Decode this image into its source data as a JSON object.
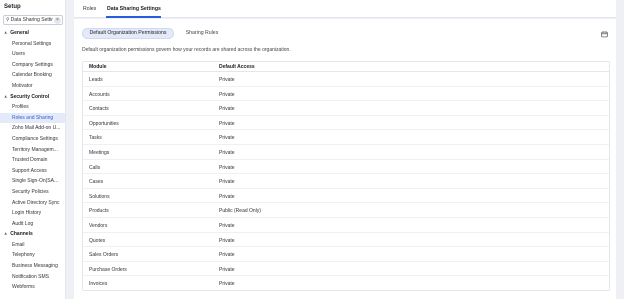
{
  "sidebar": {
    "title": "Setup",
    "search_value": "Data Sharing Settir",
    "items": [
      {
        "label": "General",
        "type": "section"
      },
      {
        "label": "Personal Settings",
        "type": "item"
      },
      {
        "label": "Users",
        "type": "item"
      },
      {
        "label": "Company Settings",
        "type": "item"
      },
      {
        "label": "Calendar Booking",
        "type": "item"
      },
      {
        "label": "Motivator",
        "type": "item"
      },
      {
        "label": "Security Control",
        "type": "section"
      },
      {
        "label": "Profiles",
        "type": "item"
      },
      {
        "label": "Roles and Sharing",
        "type": "active"
      },
      {
        "label": "Zoho Mail Add-on U...",
        "type": "item"
      },
      {
        "label": "Compliance Settings",
        "type": "item"
      },
      {
        "label": "Territory Managem...",
        "type": "item"
      },
      {
        "label": "Trusted Domain",
        "type": "item"
      },
      {
        "label": "Support Access",
        "type": "item"
      },
      {
        "label": "Single Sign-On(SA...",
        "type": "item"
      },
      {
        "label": "Security Policies",
        "type": "item"
      },
      {
        "label": "Active Directory Sync",
        "type": "item"
      },
      {
        "label": "Login History",
        "type": "item"
      },
      {
        "label": "Audit Log",
        "type": "item"
      },
      {
        "label": "Channels",
        "type": "section"
      },
      {
        "label": "Email",
        "type": "item"
      },
      {
        "label": "Telephony",
        "type": "item"
      },
      {
        "label": "Business Messaging",
        "type": "item"
      },
      {
        "label": "Notification SMS",
        "type": "item"
      },
      {
        "label": "Webforms",
        "type": "item"
      }
    ]
  },
  "topbar": {
    "tab_roles": "Roles",
    "tab_data_sharing": "Data Sharing Settings"
  },
  "content": {
    "pill_default": "Default Organization Permissions",
    "pill_sharing": "Sharing Rules",
    "description": "Default organization permissions govern how your records are shared across the organization.",
    "table": {
      "headers": [
        "Module",
        "Default Access"
      ],
      "rows": [
        [
          "Leads",
          "Private"
        ],
        [
          "Accounts",
          "Private"
        ],
        [
          "Contacts",
          "Private"
        ],
        [
          "Opportunities",
          "Private"
        ],
        [
          "Tasks",
          "Private"
        ],
        [
          "Meetings",
          "Private"
        ],
        [
          "Calls",
          "Private"
        ],
        [
          "Cases",
          "Private"
        ],
        [
          "Solutions",
          "Private"
        ],
        [
          "Products",
          "Public (Read Only)"
        ],
        [
          "Vendors",
          "Private"
        ],
        [
          "Quotes",
          "Private"
        ],
        [
          "Sales Orders",
          "Private"
        ],
        [
          "Purchase Orders",
          "Private"
        ],
        [
          "Invoices",
          "Private"
        ]
      ]
    }
  },
  "colors": {
    "accent": "#2c5cd6",
    "active_bg": "#e4eaf9"
  }
}
